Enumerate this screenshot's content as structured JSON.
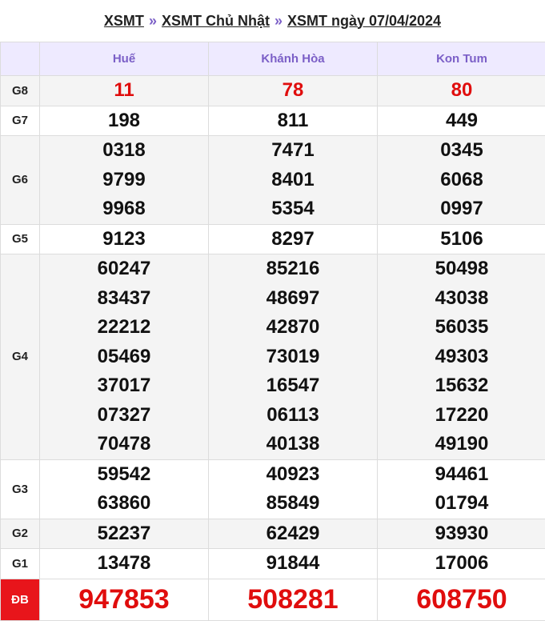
{
  "breadcrumb": {
    "items": [
      "XSMT",
      "XSMT Chủ Nhật",
      "XSMT ngày 07/04/2024"
    ],
    "separator": "»"
  },
  "provinces": [
    "Huế",
    "Khánh Hòa",
    "Kon Tum"
  ],
  "prizes": [
    {
      "label": "G8",
      "values": [
        [
          "11"
        ],
        [
          "78"
        ],
        [
          "80"
        ]
      ]
    },
    {
      "label": "G7",
      "values": [
        [
          "198"
        ],
        [
          "811"
        ],
        [
          "449"
        ]
      ]
    },
    {
      "label": "G6",
      "values": [
        [
          "0318",
          "9799",
          "9968"
        ],
        [
          "7471",
          "8401",
          "5354"
        ],
        [
          "0345",
          "6068",
          "0997"
        ]
      ]
    },
    {
      "label": "G5",
      "values": [
        [
          "9123"
        ],
        [
          "8297"
        ],
        [
          "5106"
        ]
      ]
    },
    {
      "label": "G4",
      "values": [
        [
          "60247",
          "83437",
          "22212",
          "05469",
          "37017",
          "07327",
          "70478"
        ],
        [
          "85216",
          "48697",
          "42870",
          "73019",
          "16547",
          "06113",
          "40138"
        ],
        [
          "50498",
          "43038",
          "56035",
          "49303",
          "15632",
          "17220",
          "49190"
        ]
      ]
    },
    {
      "label": "G3",
      "values": [
        [
          "59542",
          "63860"
        ],
        [
          "40923",
          "85849"
        ],
        [
          "94461",
          "01794"
        ]
      ]
    },
    {
      "label": "G2",
      "values": [
        [
          "52237"
        ],
        [
          "62429"
        ],
        [
          "93930"
        ]
      ]
    },
    {
      "label": "G1",
      "values": [
        [
          "13478"
        ],
        [
          "91844"
        ],
        [
          "17006"
        ]
      ]
    },
    {
      "label": "ĐB",
      "values": [
        [
          "947853"
        ],
        [
          "508281"
        ],
        [
          "608750"
        ]
      ]
    }
  ],
  "colors": {
    "accent": "#7b5fc7",
    "red": "#e00d0d",
    "db_bg": "#e8151b",
    "alt_row": "#f4f4f4"
  }
}
